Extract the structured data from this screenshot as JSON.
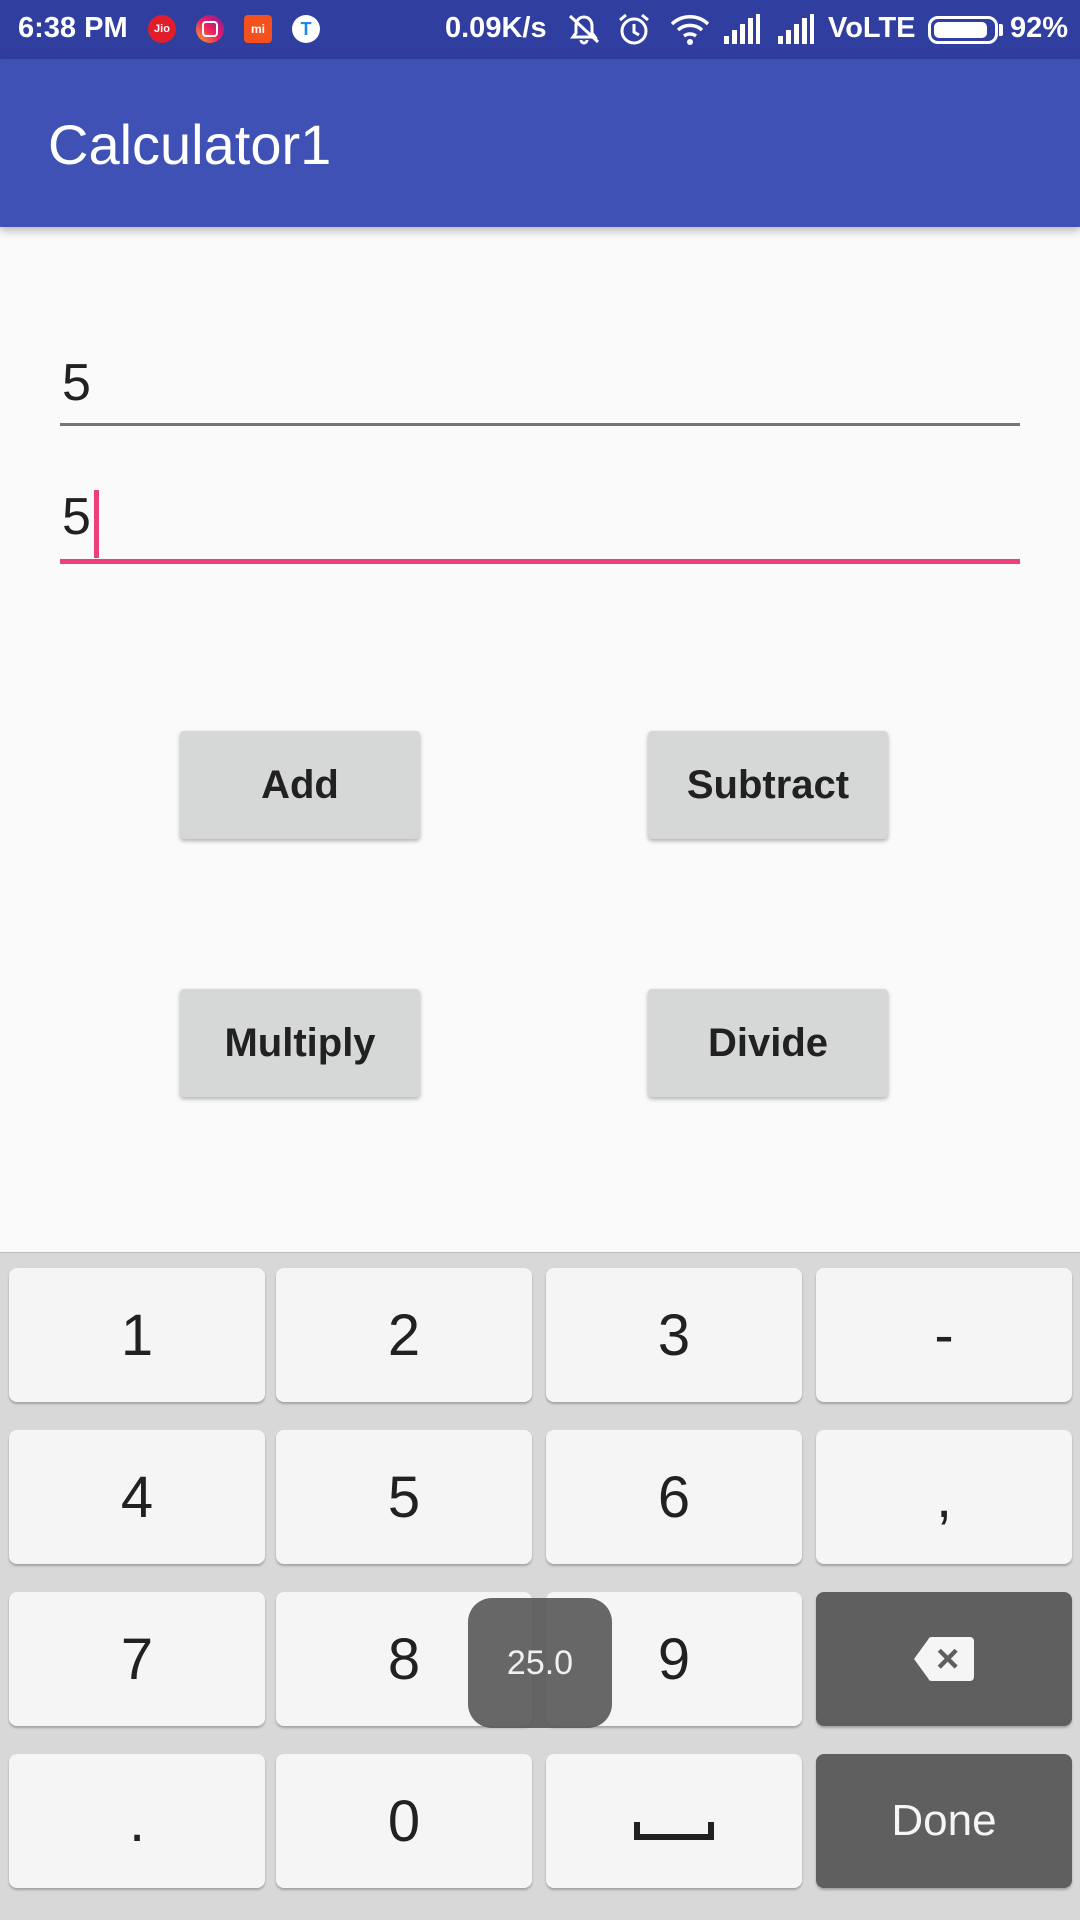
{
  "status_bar": {
    "time": "6:38 PM",
    "notifications": [
      "jio-icon",
      "instagram-icon",
      "mi-icon",
      "truecaller-icon"
    ],
    "jio_label": "Jio",
    "mi_label": "mi",
    "t_label": "T",
    "net_speed": "0.09K/s",
    "volte": "VoLTE",
    "battery_level": 0.92,
    "battery_pct": "92%"
  },
  "app_bar": {
    "title": "Calculator1"
  },
  "inputs": {
    "first_value": "5",
    "second_value": "5"
  },
  "buttons": {
    "add": "Add",
    "subtract": "Subtract",
    "multiply": "Multiply",
    "divide": "Divide"
  },
  "keyboard": {
    "keys": {
      "k1": "1",
      "k2": "2",
      "k3": "3",
      "minus": "-",
      "k4": "4",
      "k5": "5",
      "k6": "6",
      "comma": ",",
      "k7": "7",
      "k8": "8",
      "k9": "9",
      "dot": ".",
      "k0": "0",
      "done": "Done"
    },
    "accent_color": "#ec407a"
  },
  "toast": {
    "text": "25.0"
  },
  "colors": {
    "status_bar": "#303f9f",
    "app_bar": "#3f51b5",
    "accent": "#ec407a"
  }
}
